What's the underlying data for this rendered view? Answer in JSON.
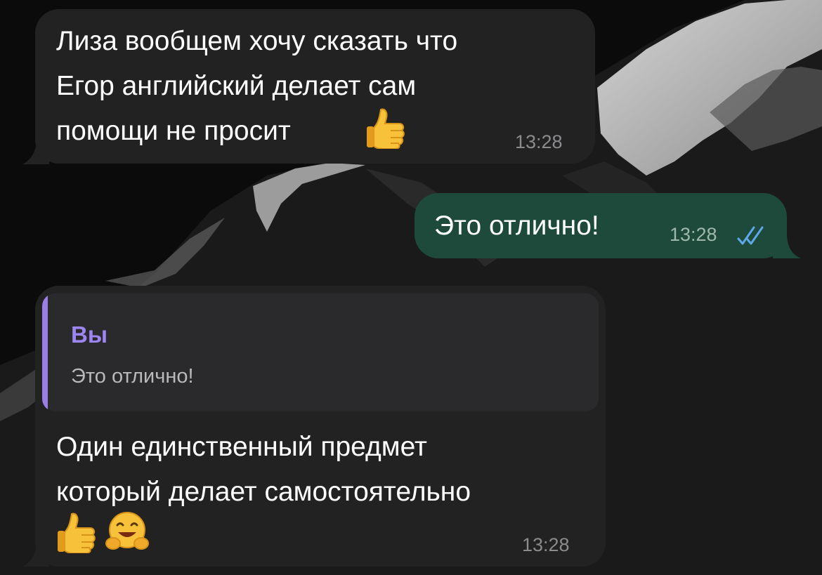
{
  "chat": {
    "messages": [
      {
        "direction": "incoming",
        "lines": [
          "Лиза вообщем хочу сказать что",
          "Егор английский делает сам",
          "помощи не просит"
        ],
        "emoji": [
          "thumbs-up-emoji"
        ],
        "time": "13:28"
      },
      {
        "direction": "outgoing",
        "lines": [
          "Это отлично!"
        ],
        "time": "13:28",
        "status": "read"
      },
      {
        "direction": "incoming",
        "reply": {
          "author": "Вы",
          "text": "Это отлично!"
        },
        "lines": [
          "Один единственный предмет",
          "который делает самостоятельно"
        ],
        "emoji": [
          "thumbs-up-emoji",
          "hugging-face-emoji"
        ],
        "time": "13:28"
      }
    ]
  },
  "colors": {
    "incoming_bubble": "#222223",
    "outgoing_bubble": "#1d4a3a",
    "reply_accent": "#9a7fe6",
    "read_checks": "#5ea8e8"
  }
}
